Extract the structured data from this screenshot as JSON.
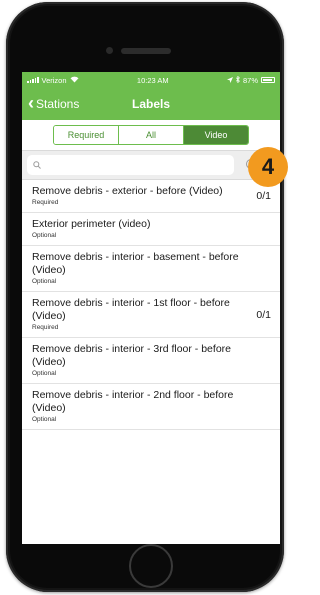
{
  "status_bar": {
    "carrier": "Verizon",
    "time": "10:23 AM",
    "battery": "87%"
  },
  "nav": {
    "back_label": "Stations",
    "title": "Labels"
  },
  "segments": [
    {
      "label": "Required",
      "active": false
    },
    {
      "label": "All",
      "active": false
    },
    {
      "label": "Video",
      "active": true
    }
  ],
  "search": {
    "placeholder": ""
  },
  "items": [
    {
      "title": "Remove debris - exterior - before (Video)",
      "subtitle": "Required",
      "count": "0/1"
    },
    {
      "title": "Exterior perimeter (video)",
      "subtitle": "Optional",
      "count": ""
    },
    {
      "title": "Remove debris - interior - basement - before (Video)",
      "subtitle": "Optional",
      "count": ""
    },
    {
      "title": "Remove debris - interior - 1st floor - before (Video)",
      "subtitle": "Required",
      "count": "0/1"
    },
    {
      "title": "Remove debris - interior - 3rd floor - before (Video)",
      "subtitle": "Optional",
      "count": ""
    },
    {
      "title": "Remove debris - interior - 2nd floor - before (Video)",
      "subtitle": "Optional",
      "count": ""
    }
  ],
  "callout": {
    "number": "4"
  },
  "colors": {
    "accent": "#6dbd4d",
    "segment_active": "#4d8a36",
    "callout": "#f29a1f"
  }
}
